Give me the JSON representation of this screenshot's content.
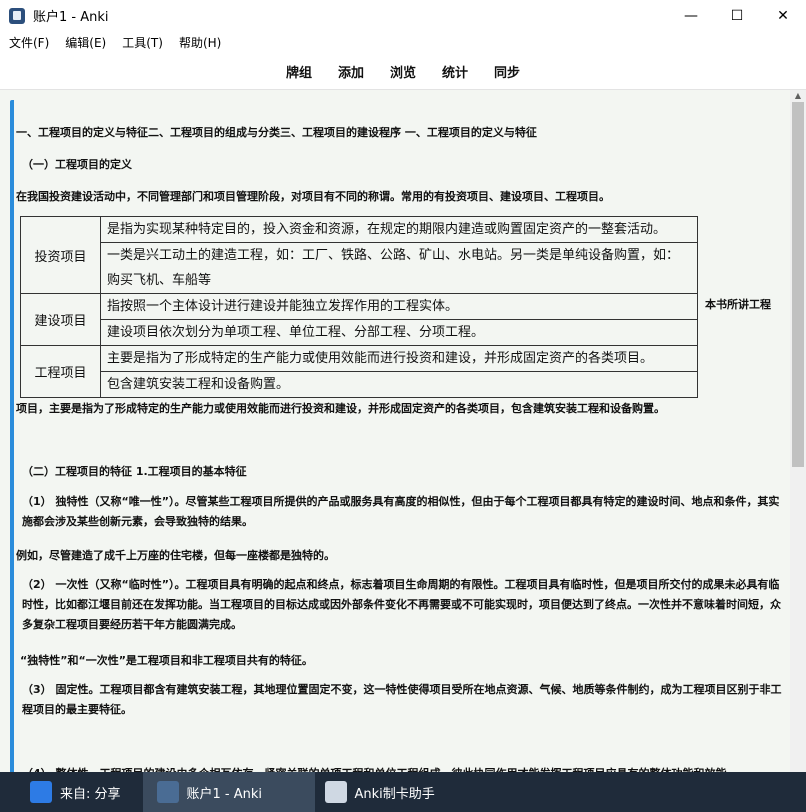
{
  "window": {
    "title": "账户1 - Anki",
    "controls": {
      "minimize": "—",
      "maximize": "☐",
      "close": "✕"
    }
  },
  "menu": [
    "文件(F)",
    "编辑(E)",
    "工具(T)",
    "帮助(H)"
  ],
  "toolbar": [
    "牌组",
    "添加",
    "浏览",
    "统计",
    "同步"
  ],
  "doc": {
    "line1": "一、工程项目的定义与特征二、工程项目的组成与分类三、工程项目的建设程序 一、工程项目的定义与特征",
    "line2": "（一）工程项目的定义",
    "line3": "在我国投资建设活动中，不同管理部门和项目管理阶段，对项目有不同的称谓。常用的有投资项目、建设项目、工程项目。",
    "table": [
      {
        "category": "投资项目",
        "rows": [
          "是指为实现某种特定目的，投入资金和资源，在规定的期限内建造或购置固定资产的一整套活动。",
          "一类是兴工动土的建造工程，如：工厂、铁路、公路、矿山、水电站。另一类是单纯设备购置，如：购买飞机、车船等"
        ]
      },
      {
        "category": "建设项目",
        "rows": [
          "指按照一个主体设计进行建设并能独立发挥作用的工程实体。",
          "建设项目依次划分为单项工程、单位工程、分部工程、分项工程。"
        ]
      },
      {
        "category": "工程项目",
        "rows": [
          "主要是指为了形成特定的生产能力或使用效能而进行投资和建设，并形成固定资产的各类项目。",
          "包含建筑安装工程和设备购置。"
        ]
      }
    ],
    "book_note": "本书所讲工程",
    "line4": "项目，主要是指为了形成特定的生产能力或使用效能而进行投资和建设，并形成固定资产的各类项目，包含建筑安装工程和设备购置。",
    "line5": "（二）工程项目的特征 1.工程项目的基本特征",
    "para1": "（1） 独特性（又称“唯一性”）。尽管某些工程项目所提供的产品或服务具有高度的相似性，但由于每个工程项目都具有特定的建设时间、地点和条件，其实施都会涉及某些创新元素，会导致独特的结果。",
    "para2": "例如，尽管建造了成千上万座的住宅楼，但每一座楼都是独特的。",
    "para3": "（2） 一次性（又称“临时性”）。工程项目具有明确的起点和终点，标志着项目生命周期的有限性。工程项目具有临时性，但是项目所交付的成果未必具有临时性，比如都江堰目前还在发挥功能。当工程项目的目标达成或因外部条件变化不再需要或不可能实现时，项目便达到了终点。一次性并不意味着时间短，众多复杂工程项目要经历若干年方能圆满完成。",
    "para4": "“独特性”和“一次性”是工程项目和非工程项目共有的特征。",
    "para5": "（3） 固定性。工程项目都含有建筑安装工程，其地理位置固定不变，这一特性使得项目受所在地点资源、气候、地质等条件制约，成为工程项目区别于非工程项目的最主要特征。",
    "para6": "（4） 整体性。工程项目的建设由多个相互依存、紧密关联的单项工程和单位工程组成，彼此协同作用才能发挥工程项目应具有的整体功能和效能。"
  },
  "taskbar": {
    "item1": "来自: 分享",
    "item2": "账户1 - Anki",
    "item3": "Anki制卡助手"
  }
}
